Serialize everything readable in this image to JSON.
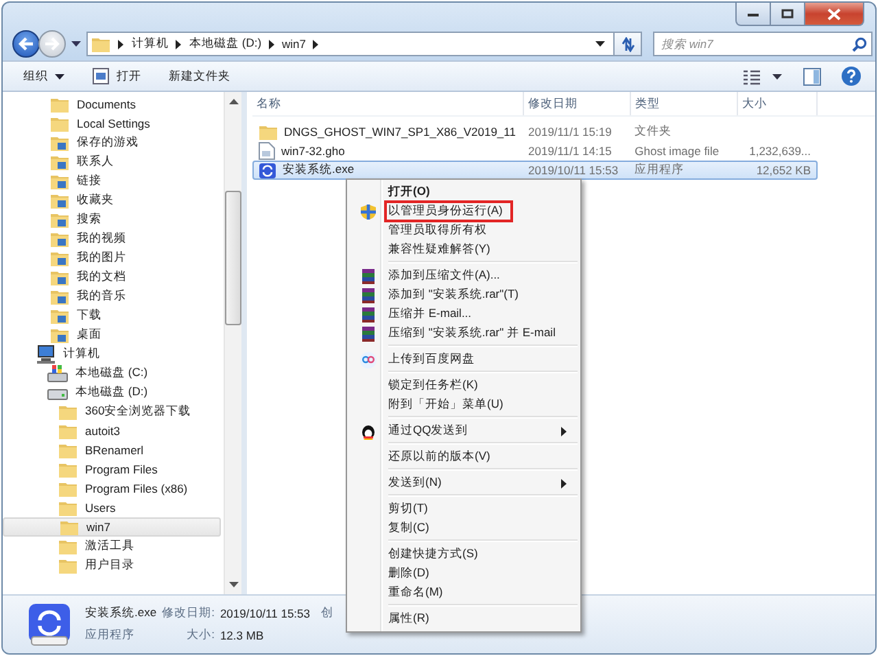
{
  "address": {
    "crumbs": [
      "计算机",
      "本地磁盘 (D:)",
      "win7"
    ]
  },
  "search": {
    "placeholder": "搜索 win7"
  },
  "toolbar": {
    "buttons": [
      {
        "label": "组织",
        "kind": "dropdown"
      },
      {
        "label": "打开",
        "kind": "open"
      },
      {
        "label": "新建文件夹",
        "kind": "plain"
      }
    ]
  },
  "nav": {
    "user_folders": [
      {
        "label": "Documents",
        "kind": "folder",
        "selected": false
      },
      {
        "label": "Local Settings",
        "kind": "folder",
        "selected": false
      },
      {
        "label": "保存的游戏",
        "kind": "library",
        "selected": false
      },
      {
        "label": "联系人",
        "kind": "library",
        "selected": false
      },
      {
        "label": "链接",
        "kind": "library",
        "selected": false
      },
      {
        "label": "收藏夹",
        "kind": "library",
        "selected": false
      },
      {
        "label": "搜索",
        "kind": "library",
        "selected": false
      },
      {
        "label": "我的视频",
        "kind": "library",
        "selected": false
      },
      {
        "label": "我的图片",
        "kind": "library",
        "selected": false
      },
      {
        "label": "我的文档",
        "kind": "library",
        "selected": false
      },
      {
        "label": "我的音乐",
        "kind": "library",
        "selected": false
      },
      {
        "label": "下载",
        "kind": "library",
        "selected": false
      },
      {
        "label": "桌面",
        "kind": "library",
        "selected": false
      }
    ],
    "items": [
      {
        "label": "计算机",
        "kind": "computer",
        "selected": false,
        "children": [
          {
            "label": "本地磁盘 (C:)",
            "kind": "system-drive",
            "selected": false
          },
          {
            "label": "本地磁盘 (D:)",
            "kind": "drive",
            "selected": false,
            "children": [
              {
                "label": "360安全浏览器下载",
                "kind": "folder",
                "selected": false
              },
              {
                "label": "autoit3",
                "kind": "folder",
                "selected": false
              },
              {
                "label": "BRenamerl",
                "kind": "folder",
                "selected": false
              },
              {
                "label": "Program Files",
                "kind": "folder",
                "selected": false
              },
              {
                "label": "Program Files (x86)",
                "kind": "folder",
                "selected": false
              },
              {
                "label": "Users",
                "kind": "folder",
                "selected": false
              },
              {
                "label": "win7",
                "kind": "folder",
                "selected": true
              },
              {
                "label": "激活工具",
                "kind": "folder",
                "selected": false
              },
              {
                "label": "用户目录",
                "kind": "folder",
                "selected": false
              }
            ]
          }
        ]
      }
    ]
  },
  "files": {
    "columns": [
      "名称",
      "修改日期",
      "类型",
      "大小"
    ],
    "rows": [
      {
        "kind": "folder",
        "name": "DNGS_GHOST_WIN7_SP1_X86_V2019_11",
        "date": "2019/11/1 15:19",
        "type": "文件夹",
        "selected": false
      },
      {
        "kind": "file",
        "name": "win7-32.gho",
        "date": "2019/11/1 14:15",
        "type": "Ghost image file",
        "size": "1,232,639...",
        "selected": false
      },
      {
        "kind": "app",
        "name": "安装系统.exe",
        "date": "2019/10/11 15:53",
        "type": "应用程序",
        "size": "12,652 KB",
        "selected": true
      }
    ]
  },
  "details": {
    "name": "安装系统.exe",
    "modified_label": "修改日期:",
    "modified": "2019/10/11 15:53",
    "created_label": "创",
    "type": "应用程序",
    "size_label": "大小:",
    "size": "12.3 MB"
  },
  "context_menu": [
    {
      "kind": "item",
      "label": "打开(O)",
      "default": true
    },
    {
      "kind": "shield",
      "label": "以管理员身份运行(A)",
      "highlighted": true
    },
    {
      "kind": "item",
      "label": "管理员取得所有权"
    },
    {
      "kind": "item",
      "label": "兼容性疑难解答(Y)"
    },
    {
      "kind": "separator"
    },
    {
      "kind": "archive",
      "label": "添加到压缩文件(A)..."
    },
    {
      "kind": "archive",
      "label": "添加到 \"安装系统.rar\"(T)"
    },
    {
      "kind": "archive",
      "label": "压缩并 E-mail..."
    },
    {
      "kind": "archive",
      "label": "压缩到 \"安装系统.rar\" 并 E-mail"
    },
    {
      "kind": "separator"
    },
    {
      "kind": "cloud",
      "label": "上传到百度网盘"
    },
    {
      "kind": "separator"
    },
    {
      "kind": "item",
      "label": "锁定到任务栏(K)"
    },
    {
      "kind": "item",
      "label": "附到「开始」菜单(U)"
    },
    {
      "kind": "separator"
    },
    {
      "kind": "qq",
      "label": "通过QQ发送到",
      "submenu": true
    },
    {
      "kind": "separator"
    },
    {
      "kind": "item",
      "label": "还原以前的版本(V)"
    },
    {
      "kind": "separator"
    },
    {
      "kind": "item",
      "label": "发送到(N)",
      "submenu": true
    },
    {
      "kind": "separator"
    },
    {
      "kind": "item",
      "label": "剪切(T)"
    },
    {
      "kind": "item",
      "label": "复制(C)"
    },
    {
      "kind": "separator"
    },
    {
      "kind": "item",
      "label": "创建快捷方式(S)"
    },
    {
      "kind": "item",
      "label": "删除(D)"
    },
    {
      "kind": "item",
      "label": "重命名(M)"
    },
    {
      "kind": "separator"
    },
    {
      "kind": "item",
      "label": "属性(R)"
    }
  ]
}
